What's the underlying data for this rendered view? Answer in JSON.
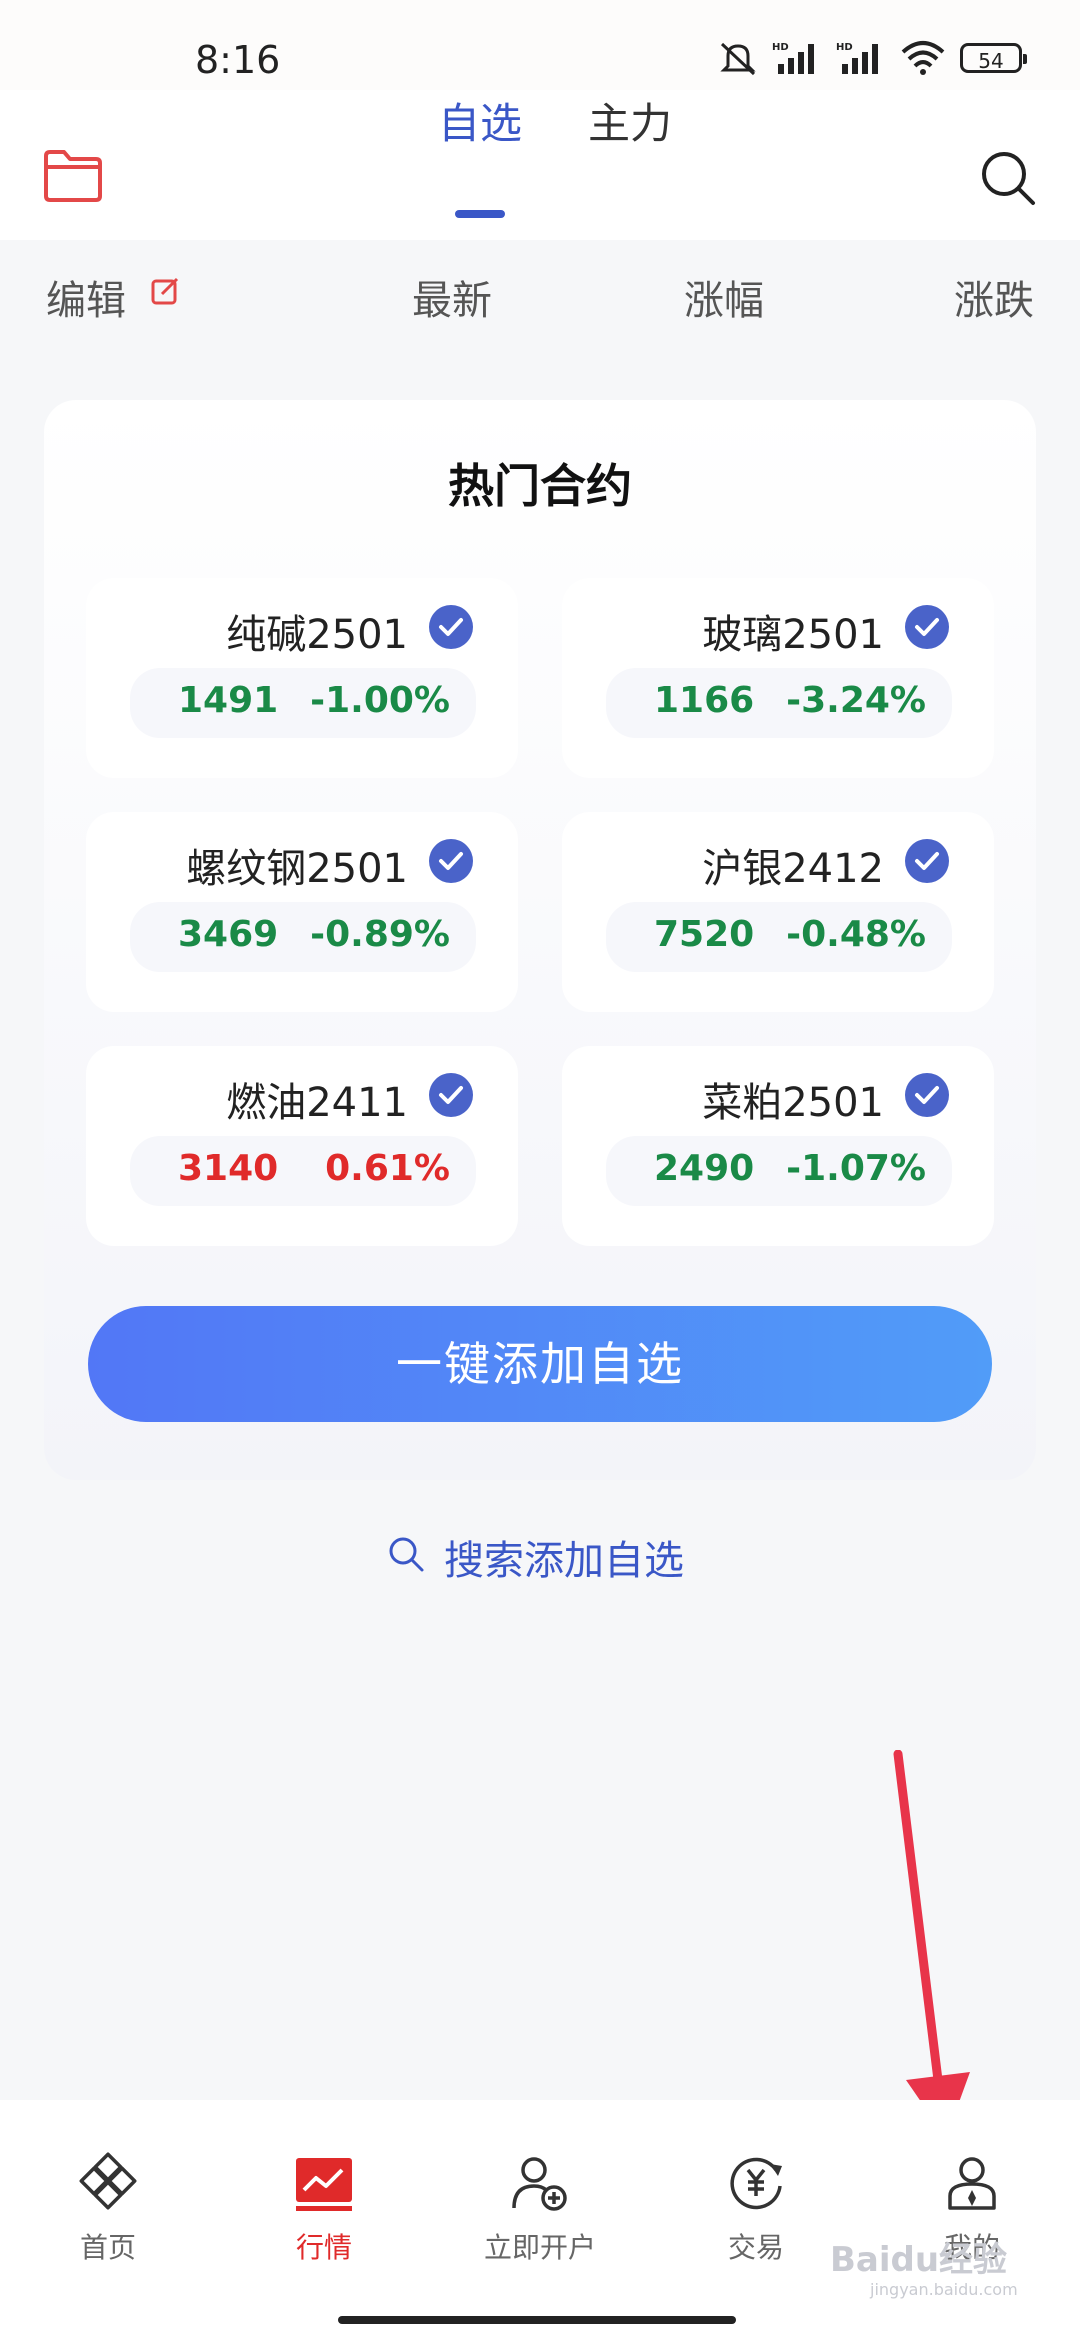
{
  "status_bar": {
    "time": "8:16",
    "battery": "54",
    "icons": [
      "mute-icon",
      "signal-hd-icon",
      "signal-hd-icon",
      "wifi-icon",
      "battery-icon"
    ]
  },
  "header": {
    "tabs": [
      {
        "label": "自选",
        "active": true
      },
      {
        "label": "主力",
        "active": false
      }
    ],
    "left_icon": "folder-icon",
    "right_icon": "search-icon"
  },
  "columns": {
    "edit": "编辑",
    "latest": "最新",
    "change_pct": "涨幅",
    "change": "涨跌"
  },
  "hot": {
    "title": "热门合约",
    "contracts": [
      {
        "name": "纯碱2501",
        "price": "1491",
        "pct": "-1.00%",
        "trend": "down",
        "checked": true
      },
      {
        "name": "玻璃2501",
        "price": "1166",
        "pct": "-3.24%",
        "trend": "down",
        "checked": true
      },
      {
        "name": "螺纹钢2501",
        "price": "3469",
        "pct": "-0.89%",
        "trend": "down",
        "checked": true
      },
      {
        "name": "沪银2412",
        "price": "7520",
        "pct": "-0.48%",
        "trend": "down",
        "checked": true
      },
      {
        "name": "燃油2411",
        "price": "3140",
        "pct": "0.61%",
        "trend": "up",
        "checked": true
      },
      {
        "name": "菜粕2501",
        "price": "2490",
        "pct": "-1.07%",
        "trend": "down",
        "checked": true
      }
    ],
    "add_button": "一键添加自选"
  },
  "search_add": "搜索添加自选",
  "bottom_nav": [
    {
      "label": "首页",
      "icon": "home-icon",
      "active": false
    },
    {
      "label": "行情",
      "icon": "market-chart-icon",
      "active": true
    },
    {
      "label": "立即开户",
      "icon": "open-account-icon",
      "active": false
    },
    {
      "label": "交易",
      "icon": "trade-yen-icon",
      "active": false
    },
    {
      "label": "我的",
      "icon": "profile-icon",
      "active": false
    }
  ],
  "watermark": {
    "text": "Baidu经验",
    "sub": "jingyan.baidu.com"
  },
  "colors": {
    "accent": "#3a57c7",
    "up": "#e02a2a",
    "down": "#1a8a47",
    "button_start": "#5277f6",
    "button_end": "#519cf8"
  }
}
